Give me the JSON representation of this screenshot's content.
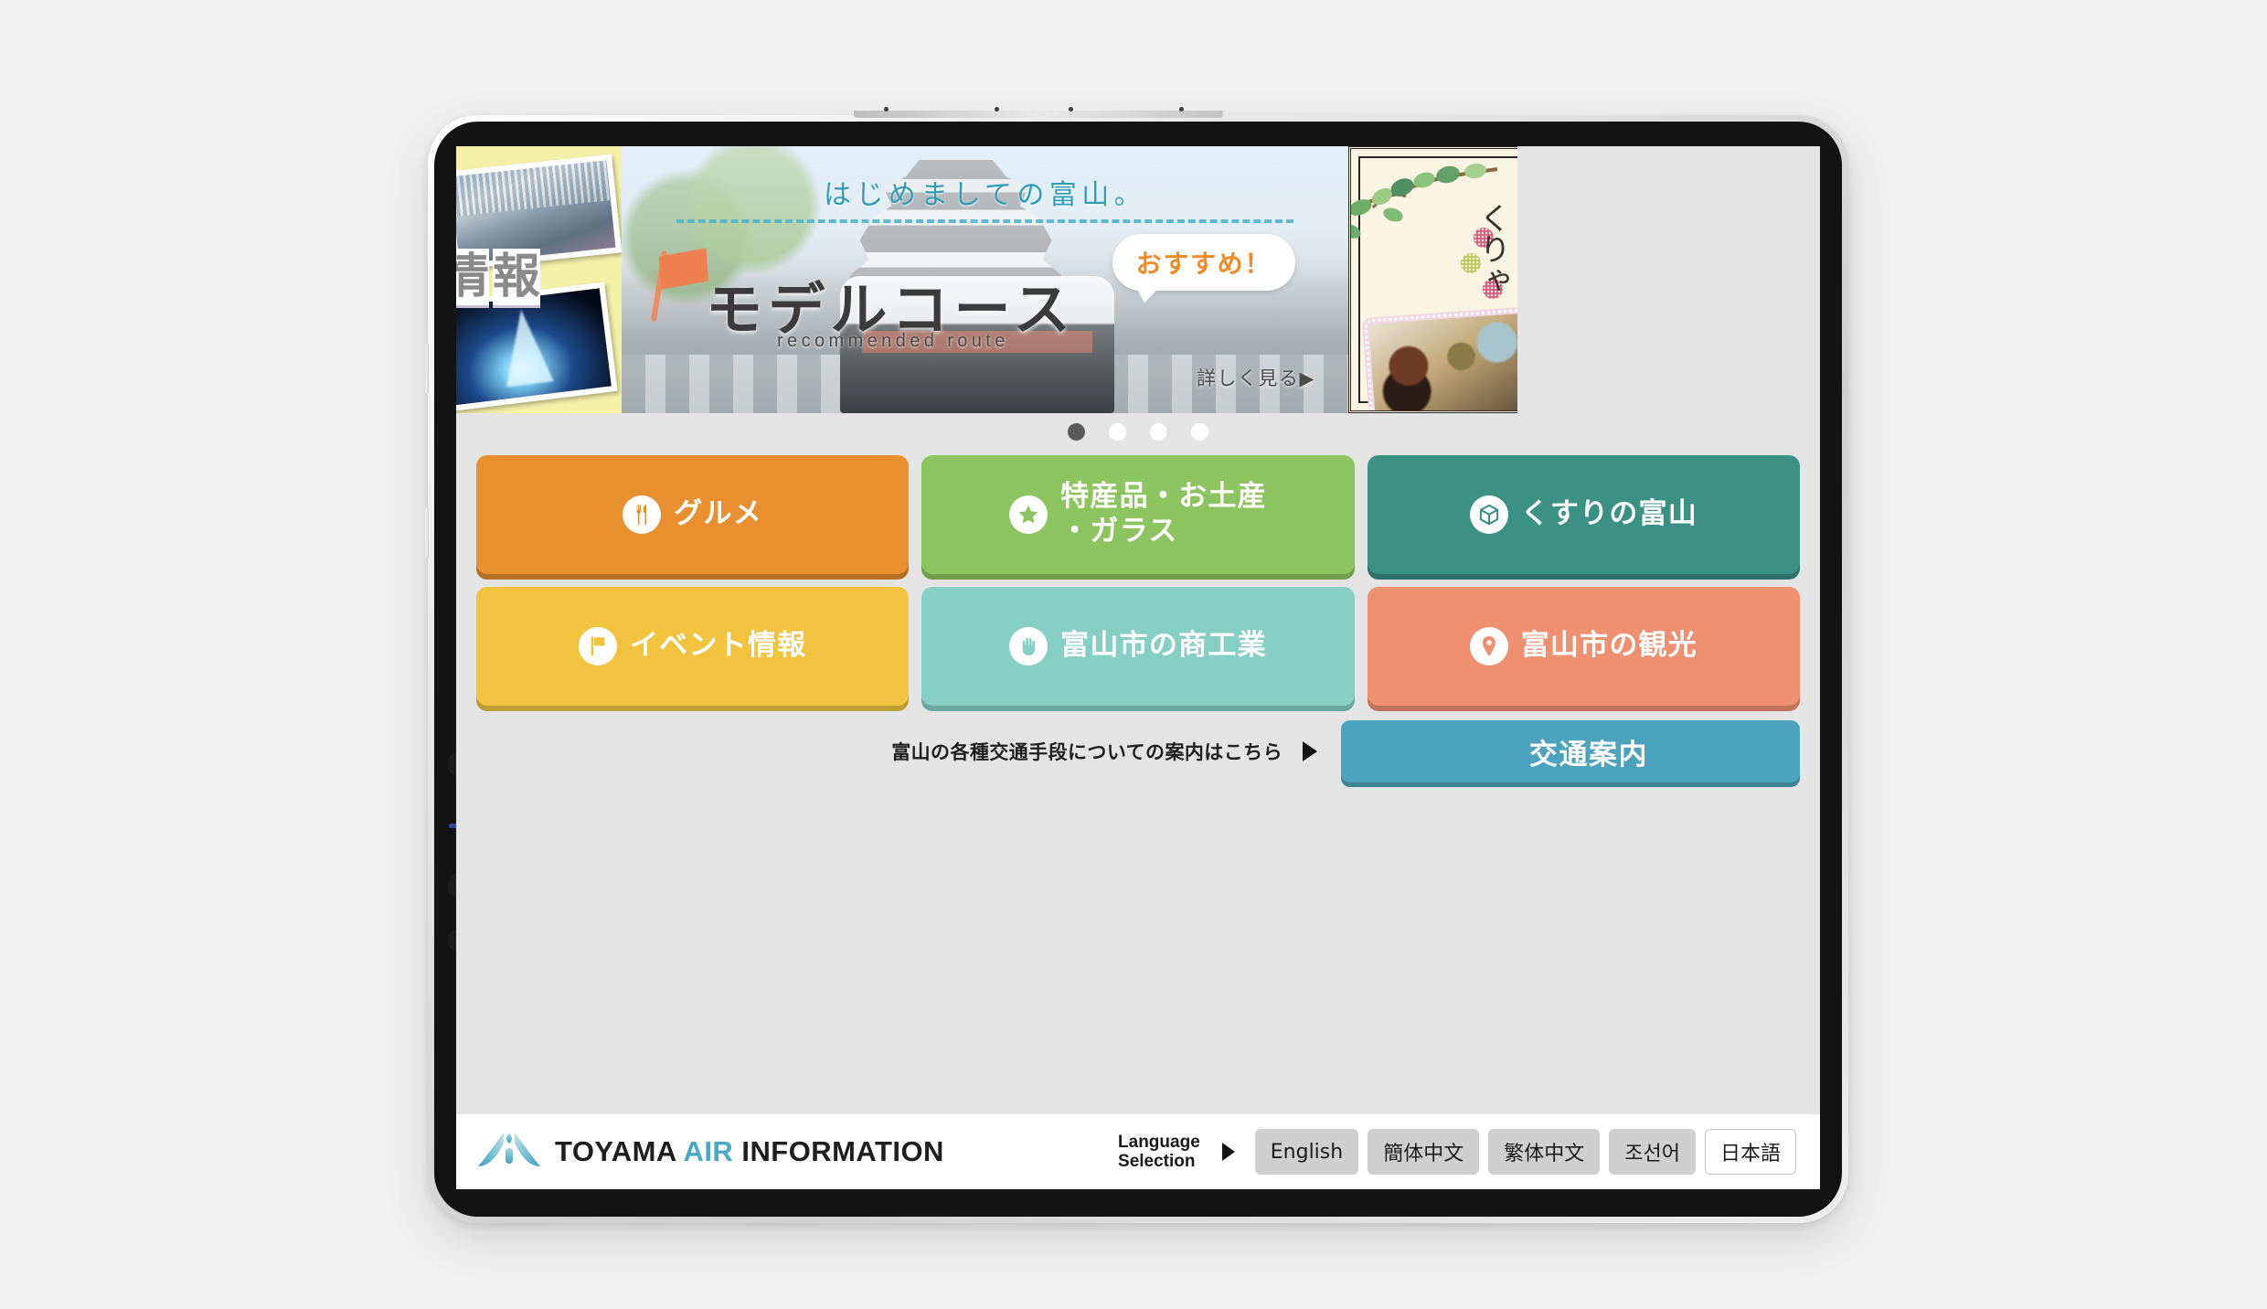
{
  "device": {
    "kind": "tablet"
  },
  "carousel": {
    "slides": [
      {
        "id": "event-info",
        "kanji": [
          "情",
          "報"
        ],
        "bg": "#f4f0a8"
      },
      {
        "id": "model-course",
        "headline": "はじめましての富山。",
        "title": "モデルコース",
        "subtitle": "recommended route",
        "badge": "おすすめ！",
        "more": "詳しく見る▶",
        "headline_color": "#2f9cb4",
        "badge_color": "#f08c28"
      },
      {
        "id": "gourmet",
        "kana": "くりゃ",
        "bg": "#faf5e3"
      }
    ],
    "dots": {
      "count": 4,
      "active_index": 0
    }
  },
  "menu": {
    "tiles": [
      {
        "label": "グルメ",
        "icon": "cutlery-icon",
        "color": "#e8902f",
        "shadow": "#b36f24"
      },
      {
        "label": "特産品・お土産\n・ガラス",
        "icon": "star-icon",
        "color": "#8cc45f",
        "shadow": "#6f9f4a"
      },
      {
        "label": "くすりの富山",
        "icon": "box-icon",
        "color": "#3c9185",
        "shadow": "#2f7168"
      },
      {
        "label": "イベント情報",
        "icon": "flag-icon",
        "color": "#f1c33f",
        "shadow": "#bf9c33"
      },
      {
        "label": "富山市の商工業",
        "icon": "hand-icon",
        "color": "#86cfc4",
        "shadow": "#6aa79e"
      },
      {
        "label": "富山市の観光",
        "icon": "pin-icon",
        "color": "#ef9070",
        "shadow": "#c0725a"
      }
    ]
  },
  "transport": {
    "note": "富山の各種交通手段についての案内はこちら",
    "button_label": "交通案内",
    "button_icon": "navigation-arrow-icon",
    "button_color": "#4ba3bd"
  },
  "footer": {
    "brand_toyama": "TOYAMA ",
    "brand_air": "AIR",
    "brand_information": " INFORMATION",
    "logo_icon": "toyama-air-logo-icon",
    "language_label": "Language\nSelection",
    "languages": [
      {
        "label": "English",
        "current": false
      },
      {
        "label": "簡体中文",
        "current": false
      },
      {
        "label": "繁体中文",
        "current": false
      },
      {
        "label": "조선어",
        "current": false
      },
      {
        "label": "日本語",
        "current": true
      }
    ]
  }
}
